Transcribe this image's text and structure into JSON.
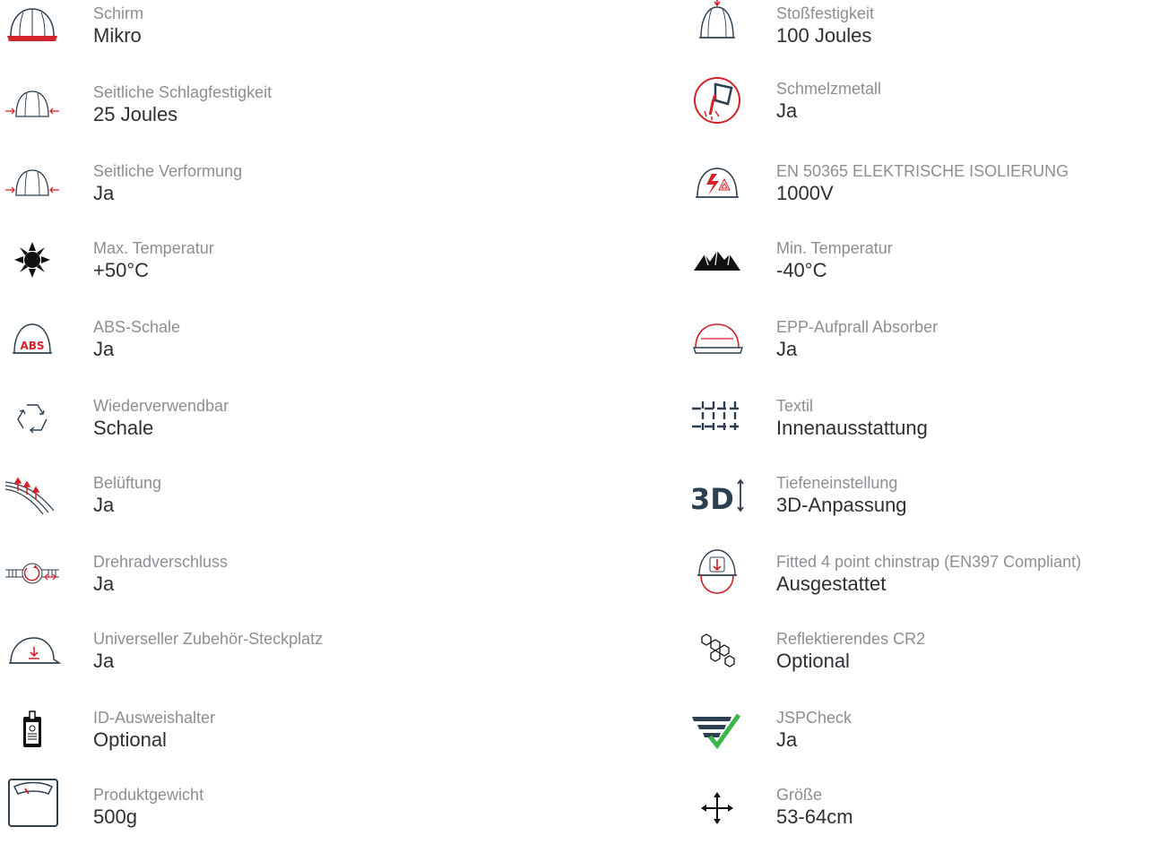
{
  "colors": {
    "accent": "#d2232a",
    "icon_dark": "#2c3e50",
    "label": "#8b8e93",
    "value": "#2c2f33",
    "check": "#3cb54a"
  },
  "left": [
    {
      "icon": "helmet-red-brim-icon",
      "label": "Schirm",
      "value": "Mikro"
    },
    {
      "icon": "side-impact-icon",
      "label": "Seitliche Schlagfestigkeit",
      "value": "25 Joules"
    },
    {
      "icon": "side-deformation-icon",
      "label": "Seitliche Verformung",
      "value": "Ja"
    },
    {
      "icon": "sun-heat-icon",
      "label": "Max. Temperatur",
      "value": "+50°C"
    },
    {
      "icon": "abs-shell-icon",
      "label": "ABS-Schale",
      "value": "Ja"
    },
    {
      "icon": "recycle-icon",
      "label": "Wiederverwendbar",
      "value": "Schale"
    },
    {
      "icon": "ventilation-icon",
      "label": "Belüftung",
      "value": "Ja"
    },
    {
      "icon": "wheel-ratchet-icon",
      "label": "Drehradverschluss",
      "value": "Ja"
    },
    {
      "icon": "accessory-slot-icon",
      "label": "Universeller Zubehör-Steckplatz",
      "value": "Ja"
    },
    {
      "icon": "id-badge-icon",
      "label": "ID-Ausweishalter",
      "value": "Optional"
    },
    {
      "icon": "weight-scale-icon",
      "label": "Produktgewicht",
      "value": "500g"
    }
  ],
  "right": [
    {
      "icon": "top-impact-icon",
      "label": "Stoßfestigkeit",
      "value": "100 Joules"
    },
    {
      "icon": "molten-metal-icon",
      "label": "Schmelzmetall",
      "value": "Ja"
    },
    {
      "icon": "electrical-insulation-icon",
      "label": "EN 50365 ELEKTRISCHE ISOLIERUNG",
      "value": "1000V"
    },
    {
      "icon": "mountain-cold-icon",
      "label": "Min. Temperatur",
      "value": "-40°C"
    },
    {
      "icon": "epp-liner-icon",
      "label": "EPP-Aufprall Absorber",
      "value": "Ja"
    },
    {
      "icon": "textile-icon",
      "label": "Textil",
      "value": "Innenausstattung"
    },
    {
      "icon": "3d-adjust-icon",
      "label": "Tiefeneinstellung",
      "value": "3D-Anpassung"
    },
    {
      "icon": "chinstrap-icon",
      "label": "Fitted 4 point chinstrap (EN397 Compliant)",
      "value": "Ausgestattet"
    },
    {
      "icon": "reflective-icon",
      "label": "Reflektierendes CR2",
      "value": "Optional"
    },
    {
      "icon": "jspcheck-icon",
      "label": "JSPCheck",
      "value": "Ja"
    },
    {
      "icon": "size-arrows-icon",
      "label": "Größe",
      "value": "53-64cm"
    }
  ]
}
